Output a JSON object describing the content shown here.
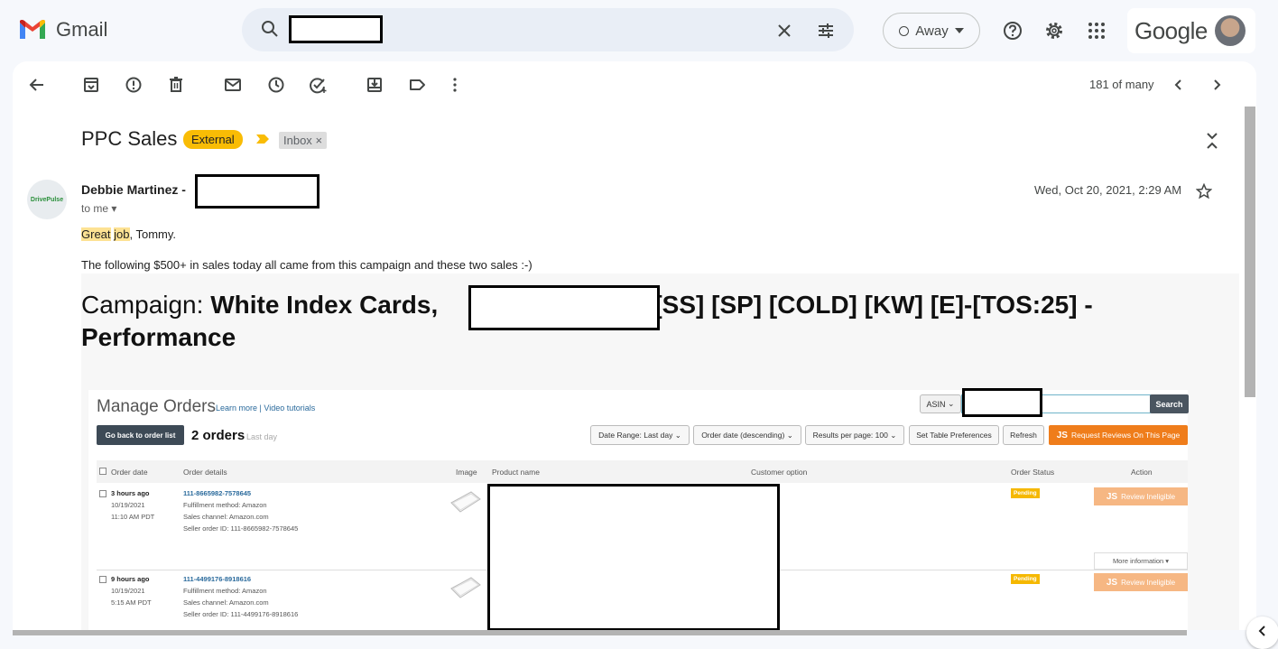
{
  "app": {
    "name": "Gmail",
    "brand_word": "Google"
  },
  "status": {
    "label": "Away"
  },
  "toolbar": {
    "pager": "181 of many"
  },
  "email": {
    "subject": "PPC Sales",
    "labels": [
      "External",
      "Inbox"
    ],
    "label_remove": "×",
    "sender_name": "Debbie Martinez",
    "sender_sep": "-",
    "recipient": "to me",
    "date": "Wed, Oct 20, 2021, 2:29 AM",
    "greeting_hl1": "Great",
    "greeting_hl2": "job",
    "greeting_rest": ", Tommy.",
    "body_line": "The following $500+ in sales today all came from this campaign and these two sales :-)",
    "campaign_prefix": "Campaign: ",
    "campaign_name_1": "White Index Cards,",
    "campaign_name_2": "- [SS] [SP] [COLD] [KW] [E]-[TOS:25] -",
    "campaign_name_3": "Performance"
  },
  "avatar_badge": "DrivePulse",
  "amazon": {
    "title": "Manage Orders",
    "learn_more": "Learn more",
    "video_tutorials": "Video tutorials",
    "asin_label": "ASIN",
    "search_button": "Search",
    "back_button": "Go back to order list",
    "orders_count": "2 orders",
    "orders_period": "Last day",
    "date_range": "Date Range: Last day",
    "sort": "Order date (descending)",
    "per_page": "Results per page: 100",
    "table_prefs": "Set Table Preferences",
    "refresh": "Refresh",
    "request_reviews": "Request Reviews On This Page",
    "js_badge": "JS",
    "columns": [
      "Order date",
      "Order details",
      "Image",
      "Product name",
      "Customer option",
      "Order Status",
      "Action"
    ],
    "orders": [
      {
        "age": "3 hours ago",
        "date": "10/19/2021",
        "time": "11:10 AM PDT",
        "order_id": "111-8665982-7578645",
        "fulfillment": "Fulfillment method: Amazon",
        "channel": "Sales channel: Amazon.com",
        "seller_id": "Seller order ID: 111-8665982-7578645",
        "status": "Pending",
        "action": "Review Ineligible"
      },
      {
        "age": "9 hours ago",
        "date": "10/19/2021",
        "time": "5:15 AM PDT",
        "order_id": "111-4499176-8918616",
        "fulfillment": "Fulfillment method: Amazon",
        "channel": "Sales channel: Amazon.com",
        "seller_id": "Seller order ID: 111-4499176-8918616",
        "status": "Pending",
        "action": "Review Ineligible"
      }
    ],
    "more_information": "More information ▾"
  },
  "colors": {
    "external_tag": "#f9bc05",
    "request_btn": "#ef7d1b",
    "pending": "#f5b800",
    "gmail_red": "#ea4335"
  },
  "icons": [
    "gmail-logo-icon",
    "search-icon",
    "clear-icon",
    "filter-icon",
    "help-icon",
    "settings-icon",
    "apps-icon",
    "back-arrow-icon",
    "archive-icon",
    "spam-icon",
    "delete-icon",
    "mark-unread-icon",
    "snooze-icon",
    "add-task-icon",
    "move-to-icon",
    "label-icon",
    "more-icon",
    "chevron-left-icon",
    "chevron-right-icon",
    "collapse-icon",
    "star-icon"
  ]
}
